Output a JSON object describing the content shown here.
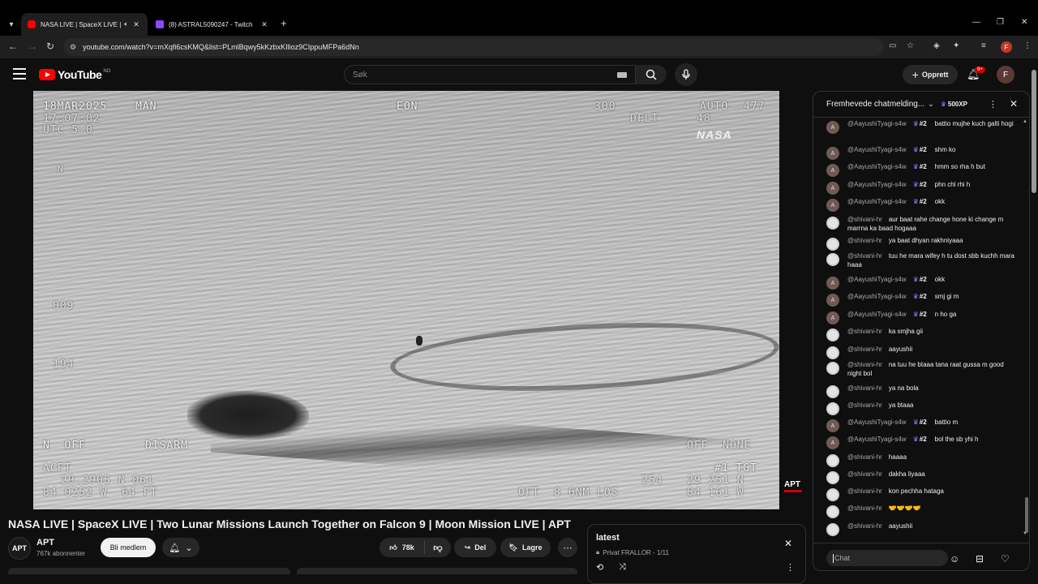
{
  "browser": {
    "tabs": [
      {
        "title": "NASA LIVE | SpaceX LIVE | T",
        "active": true
      },
      {
        "title": "(8) ASTRAL5090247 - Twitch",
        "active": false
      }
    ],
    "url": "youtube.com/watch?v=mXqfi6csKMQ&list=PLmlBqwy5kKzbxKIlioz9CIppuMFPa6dNn",
    "profile_initial": "F"
  },
  "youtube": {
    "logo_text": "YouTube",
    "region": "NO",
    "search_placeholder": "Søk",
    "create_label": "Opprett",
    "notification_count": "9+",
    "avatar_initial": "F"
  },
  "video": {
    "hud": {
      "date": "18MAR2025",
      "mode": "MAN",
      "eon": "EON",
      "time": "17:07:02",
      "utc": "UTC 5.0",
      "heading": "300",
      "dflt": "DFLT",
      "auto": "AUTO",
      "auto_val": "477",
      "hdg2": "48",
      "n_mark": "N",
      "v1": "009",
      "v2": "194",
      "left_status": "N  OFF",
      "disarm": "DISARM",
      "off_none": "OFF  NONE",
      "acft": "ACFT",
      "lat": "29.2905 N 061",
      "lon": "84 0252 W  64 FT",
      "tgt": "#1 TGT",
      "tgt_lat": "29 251 N",
      "tgt_lon": "84 161 W",
      "range1": "254",
      "range2": "OFT  8 6NM LOS"
    },
    "nasa_logo": "NASA",
    "apt_watermark": "APT",
    "title": "NASA LIVE | SpaceX LIVE | Two Lunar Missions Launch Together on Falcon 9 | Moon Mission LIVE | APT",
    "channel": {
      "avatar": "APT",
      "name": "APT",
      "subscribers": "767k abonnenter"
    },
    "join_label": "Bli medlem",
    "likes": "78k",
    "share_label": "Del",
    "save_label": "Lagre"
  },
  "playlist": {
    "title": "latest",
    "meta": "Privat FRALLOR - 1/11"
  },
  "chat": {
    "header_title": "Fremhevede chatmelding...",
    "xp": "500XP",
    "input_placeholder": "Chat",
    "messages": [
      {
        "author": "@AayushiTyagi-s4w",
        "badge": "#2",
        "text": "battio mujhe kuch galti hogi",
        "av": "A"
      },
      {
        "author": "@AayushiTyagi-s4w",
        "badge": "#2",
        "text": "shm ko",
        "av": "A"
      },
      {
        "author": "@AayushiTyagi-s4w",
        "badge": "#2",
        "text": "hmm so rha h but",
        "av": "A"
      },
      {
        "author": "@AayushiTyagi-s4w",
        "badge": "#2",
        "text": "phn chl rhi h",
        "av": "A"
      },
      {
        "author": "@AayushiTyagi-s4w",
        "badge": "#2",
        "text": "okk",
        "av": "A"
      },
      {
        "author": "@shivani-hr",
        "badge": "",
        "text": "aur baat rahe change hone ki change m marrna ka baad hogaaa",
        "av": ""
      },
      {
        "author": "@shivani-hr",
        "badge": "",
        "text": "ya baat dhyan rakhniyaaa",
        "av": ""
      },
      {
        "author": "@shivani-hr",
        "badge": "",
        "text": "tuu he mara wifey h tu dost sbb kuchh mara haaa",
        "av": ""
      },
      {
        "author": "@AayushiTyagi-s4w",
        "badge": "#2",
        "text": "okk",
        "av": "A"
      },
      {
        "author": "@AayushiTyagi-s4w",
        "badge": "#2",
        "text": "smj gi m",
        "av": "A"
      },
      {
        "author": "@AayushiTyagi-s4w",
        "badge": "#2",
        "text": "n ho ga",
        "av": "A"
      },
      {
        "author": "@shivani-hr",
        "badge": "",
        "text": "ka smjha gii",
        "av": ""
      },
      {
        "author": "@shivani-hr",
        "badge": "",
        "text": "aayushii",
        "av": ""
      },
      {
        "author": "@shivani-hr",
        "badge": "",
        "text": "na tuu he btaaa tana raat gussa m good night bol",
        "av": ""
      },
      {
        "author": "@shivani-hr",
        "badge": "",
        "text": "ya na bola",
        "av": ""
      },
      {
        "author": "@shivani-hr",
        "badge": "",
        "text": "ya btaaa",
        "av": ""
      },
      {
        "author": "@AayushiTyagi-s4w",
        "badge": "#2",
        "text": "battio m",
        "av": "A"
      },
      {
        "author": "@AayushiTyagi-s4w",
        "badge": "#2",
        "text": "bol the sb yhi h",
        "av": "A"
      },
      {
        "author": "@shivani-hr",
        "badge": "",
        "text": "haaaa",
        "av": ""
      },
      {
        "author": "@shivani-hr",
        "badge": "",
        "text": "dakha liyaaa",
        "av": ""
      },
      {
        "author": "@shivani-hr",
        "badge": "",
        "text": "kon pechha hataga",
        "av": ""
      },
      {
        "author": "@shivani-hr",
        "badge": "",
        "text": "🤝🤝🤝🤝",
        "av": ""
      },
      {
        "author": "@shivani-hr",
        "badge": "",
        "text": "aayushii",
        "av": ""
      }
    ]
  },
  "icons": {
    "tab_search": "chevron-down-icon",
    "back": "arrow-left-icon",
    "reload": "reload-icon",
    "search": "magnifier-icon",
    "mic": "microphone-icon",
    "bell": "bell-icon",
    "like": "thumbs-up-icon",
    "dislike": "thumbs-down-icon",
    "share": "share-arrow-icon",
    "save": "bookmark-icon",
    "emoji": "smiley-icon",
    "heart": "heart-icon"
  },
  "colors": {
    "yt_red": "#ff0000",
    "badge_purple": "#8e7cff",
    "background": "#0f0f0f"
  }
}
